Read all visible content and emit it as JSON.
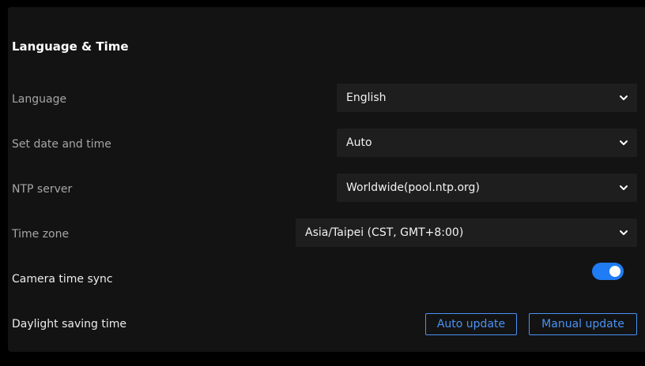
{
  "section": {
    "title": "Language & Time"
  },
  "language": {
    "label": "Language",
    "value": "English"
  },
  "date_time": {
    "label": "Set date and time",
    "value": "Auto"
  },
  "ntp": {
    "label": "NTP server",
    "value": "Worldwide(pool.ntp.org)"
  },
  "timezone": {
    "label": "Time zone",
    "value": "Asia/Taipei (CST, GMT+8:00)"
  },
  "camera_sync": {
    "label": "Camera time sync",
    "enabled": true
  },
  "dst": {
    "label": "Daylight saving time",
    "auto_label": "Auto update",
    "manual_label": "Manual update"
  },
  "colors": {
    "accent": "#1f7cf4",
    "button_text": "#4a92f5",
    "panel_bg": "#131313",
    "select_bg": "#1e1e1e"
  },
  "icons": {
    "dropdown": "chevron-down-icon"
  }
}
